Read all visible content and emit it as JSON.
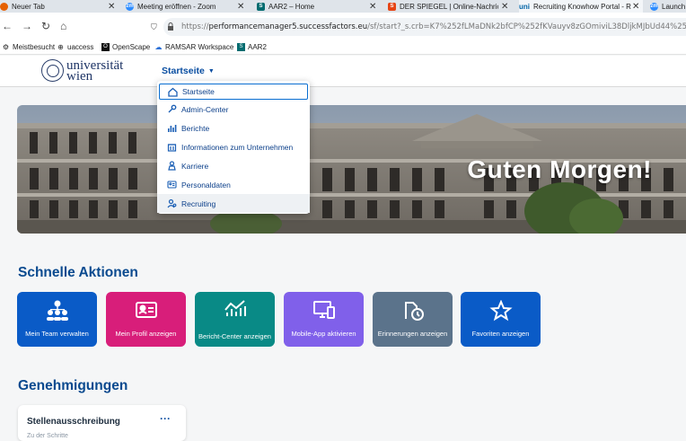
{
  "browser": {
    "tabs": [
      {
        "label": "Neuer Tab",
        "icon": "firefox-icon",
        "color": "#e66000"
      },
      {
        "label": "Meeting eröffnen - Zoom",
        "icon": "zoom-icon",
        "color": "#2d8cff"
      },
      {
        "label": "AAR2 – Home",
        "icon": "sharepoint-icon",
        "color": "#036c70"
      },
      {
        "label": "DER SPIEGEL | Online-Nachricht",
        "icon": "spiegel-icon",
        "color": "#e64415"
      },
      {
        "label": "Recruiting Knowhow Portal - R",
        "icon": "uni-icon",
        "color": "#0063a6"
      },
      {
        "label": "Launch",
        "icon": "zoom-icon",
        "color": "#2d8cff"
      }
    ],
    "url_prefix": "https://",
    "url_host": "performancemanager5.successfactors.eu",
    "url_path": "/sf/start?_s.crb=K7%252fLMaDNk2bfCP%252fKVauyv8zGOmiviL38DljkMJbUd44%253d",
    "bookmarks": [
      {
        "label": "Meistbesucht",
        "icon": "gear-icon"
      },
      {
        "label": "uaccess",
        "icon": "globe-icon"
      },
      {
        "label": "OpenScape",
        "icon": "openscape-icon"
      },
      {
        "label": "RAMSAR Workspace",
        "icon": "cloud-icon"
      },
      {
        "label": "AAR2",
        "icon": "sharepoint-icon"
      }
    ]
  },
  "header": {
    "logo_line1": "universität",
    "logo_line2": "wien",
    "nav_label": "Startseite"
  },
  "menu": {
    "items": [
      {
        "label": "Startseite",
        "icon": "home-icon"
      },
      {
        "label": "Admin-Center",
        "icon": "wrench-icon"
      },
      {
        "label": "Berichte",
        "icon": "bar-chart-icon"
      },
      {
        "label": "Informationen zum Unternehmen",
        "icon": "building-icon"
      },
      {
        "label": "Karriere",
        "icon": "career-icon"
      },
      {
        "label": "Personaldaten",
        "icon": "id-card-icon"
      },
      {
        "label": "Recruiting",
        "icon": "recruiting-icon"
      }
    ]
  },
  "hero": {
    "greeting": "Guten Morgen!"
  },
  "quick_actions": {
    "title": "Schnelle Aktionen",
    "tiles": [
      {
        "label": "Mein Team verwalten",
        "icon": "team-hierarchy-icon",
        "color": "#0a5bc7"
      },
      {
        "label": "Mein Profil anzeigen",
        "icon": "profile-card-icon",
        "color": "#d81e7a"
      },
      {
        "label": "Bericht-Center anzeigen",
        "icon": "line-chart-icon",
        "color": "#098a86"
      },
      {
        "label": "Mobile-App aktivieren",
        "icon": "devices-icon",
        "color": "#8060ea"
      },
      {
        "label": "Erinnerungen anzeigen",
        "icon": "reminder-clock-icon",
        "color": "#5b738b"
      },
      {
        "label": "Favoriten anzeigen",
        "icon": "star-icon",
        "color": "#0a5bc7"
      }
    ]
  },
  "approvals": {
    "title": "Genehmigungen",
    "card_title": "Stellenausschreibung",
    "card_more": "···",
    "card_sub": "Zu der Schritte"
  }
}
